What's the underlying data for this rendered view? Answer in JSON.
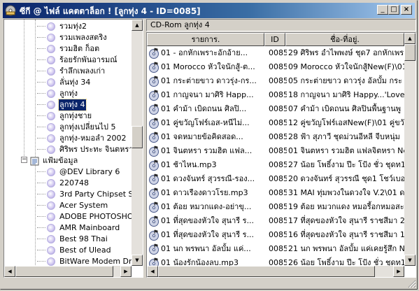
{
  "window": {
    "title": "ซีกี @ ไฟล์ แคตตาล็อก ! [ลูกทุ่ง 4 - ID=0085]",
    "minimize_label": "_",
    "maximize_label": "□",
    "close_label": "×"
  },
  "tree": {
    "items": [
      {
        "label": "รวมทุ่ง2",
        "type": "disc"
      },
      {
        "label": "รวมเพลงสตริง",
        "type": "disc"
      },
      {
        "label": "รวมฮิต ก็อต",
        "type": "disc"
      },
      {
        "label": "ร้อยรักพันอารมณ์",
        "type": "disc"
      },
      {
        "label": "รำลึกเพลงเก่า",
        "type": "disc"
      },
      {
        "label": "ลั่นทุ่ง 34",
        "type": "disc"
      },
      {
        "label": "ลูกทุ่ง",
        "type": "disc"
      },
      {
        "label": "ลูกทุ่ง 4",
        "type": "disc",
        "selected": true
      },
      {
        "label": "ลูกทุ่งชาย",
        "type": "disc"
      },
      {
        "label": "ลูกทุ่งเปลี่ยนไป 5",
        "type": "disc"
      },
      {
        "label": "ลูกทุ่ง-หมอลำ 2002",
        "type": "disc"
      },
      {
        "label": "ศิริพร ประทะ จินตหรา",
        "type": "disc"
      },
      {
        "label": "แฟ้มข้อมูล",
        "type": "folder"
      },
      {
        "label": "@DEV Library 6",
        "type": "disc"
      },
      {
        "label": "220748",
        "type": "disc"
      },
      {
        "label": "3rd Party Chipset Ser",
        "type": "disc"
      },
      {
        "label": "Acer System",
        "type": "disc"
      },
      {
        "label": "ADOBE PHOTOSHOP",
        "type": "disc"
      },
      {
        "label": "AMR Mainboard",
        "type": "disc"
      },
      {
        "label": "Best 98 Thai",
        "type": "disc"
      },
      {
        "label": "Best of Ulead",
        "type": "disc"
      },
      {
        "label": "BitWare Modem Drive",
        "type": "disc"
      }
    ],
    "expander_minus": "−"
  },
  "right_header": "CD-Rom ลูกทุ่ง 4",
  "list": {
    "columns": [
      "รายการ.",
      "ID",
      "ชื่อ-ที่อยู่."
    ],
    "rows": [
      {
        "name": "01 - อกหักเพราะอักอ้าย...",
        "id": "0085",
        "path": "29 ศิริพร อำไพพงษ์ ชุด7 อกหักเพร"
      },
      {
        "name": "01 Morocco หัวใจนักสู้-ต...",
        "id": "0085",
        "path": "09 Morocco หัวใจนักสู้New(F)\\01"
      },
      {
        "name": "01 กระต่ายขาว ดาวรุ่ง-กร...",
        "id": "0085",
        "path": "05 กระต่ายขาว ดาวรุ่ง อัลบั้ม กระ"
      },
      {
        "name": "01 กาญจนา มาศิริ Happ...",
        "id": "0085",
        "path": "18 กาญจนา มาศิริ Happy...'Love'"
      },
      {
        "name": "01 คำม้า เบิดถนน ศิลปิ...",
        "id": "0085",
        "path": "07 คำม้า เบิดถนน ศิลปินพื้นฐานพู"
      },
      {
        "name": "01 คู่ขวัญโฟร์เอส-หนีไม่...",
        "id": "0085",
        "path": "12 คู่ขวัญโฟร์เอสNew(F)\\01 คู่ขวั"
      },
      {
        "name": "01 จดหมายข้อคิดสอด...",
        "id": "0085",
        "path": "28 ฟ้า สุภาวี ชุดม่วนอีหลี จีบหนุ่ม"
      },
      {
        "name": "01 จินตหรา รวมฮิต แฟล...",
        "id": "0085",
        "path": "01 จินตหรา รวมฮิต แฟลจิตหรา Ne"
      },
      {
        "name": "01 ช้าไหน.mp3",
        "id": "0085",
        "path": "27 น้อย โพธิ์งาม ปีะ โป้ง ชั่ว ชุดท1"
      },
      {
        "name": "01 ดวงจันทร์ สุวรรณี-รอง...",
        "id": "0085",
        "path": "20 ดวงจันทร์ สุวรรณี ชุด1 โชว์เบอ"
      },
      {
        "name": "01 ดาวเรืองดาวโรย.mp3",
        "id": "0085",
        "path": "31 MAI ทุ่มพวงในดวงใจ V.2\\01 ด"
      },
      {
        "name": "01 ต้อย หมวกแดง-อย่าขุ...",
        "id": "0085",
        "path": "19 ต้อย หมวกแดง หมอรี้อกหมอสะ"
      },
      {
        "name": "01 ที่สุดของหัวใจ สุนารี ร...",
        "id": "0085",
        "path": "17 ที่สุดของหัวใจ สุนารี ราชสีมา 2"
      },
      {
        "name": "01 ที่สุดของหัวใจ สุนารี ร...",
        "id": "0085",
        "path": "16 ที่สุดของหัวใจ สุนารี ราชสีมา 1"
      },
      {
        "name": "01 นก พรพนา อัลบั้ม แค่...",
        "id": "0085",
        "path": "21 นก พรพนา อัลบั้ม แค่เคยรู้สึก N"
      },
      {
        "name": "01 น้องรักน้องลบ.mp3",
        "id": "0085",
        "path": "26 น้อย โพธิ์งาม ปีะ โป้ง ชั่ว ชุดท1"
      }
    ]
  },
  "colors": {
    "title_start": "#0a246a",
    "title_end": "#a6caf0",
    "selection": "#0a246a",
    "window_bg": "#d4d0c8"
  }
}
